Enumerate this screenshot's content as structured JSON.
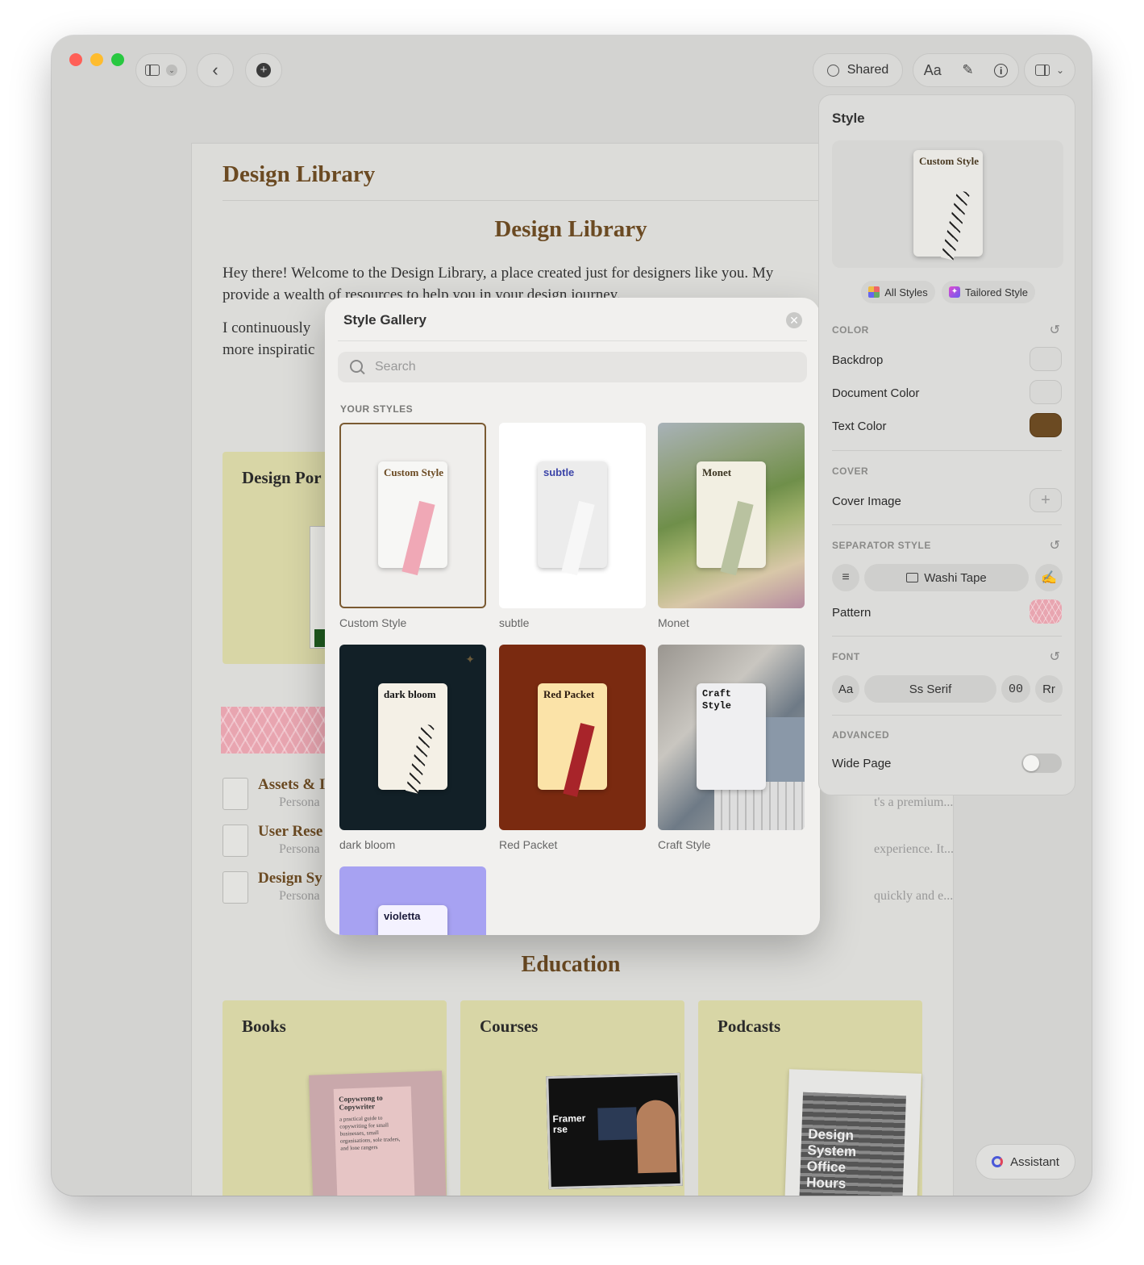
{
  "toolbar": {
    "shared_label": "Shared",
    "font_button_label": "Aa"
  },
  "document": {
    "header_title": "Design Library",
    "main_title": "Design Library",
    "intro_line1": "Hey there! Welcome to the Design Library, a place created just for designers like you. My",
    "intro_line2": "provide a wealth of resources to help you in your design journey.",
    "second_line1": "I continuously",
    "second_line2": "more inspiratic",
    "design_card_title": "Design Por",
    "list_items": [
      {
        "title": "Assets & I",
        "subtitle": "Persona"
      },
      {
        "title": "User Rese",
        "subtitle": "Persona"
      },
      {
        "title": "Design Sy",
        "subtitle": "Persona"
      }
    ],
    "right_snippets": [
      "t's a premium...",
      "experience. It...",
      "quickly and e..."
    ],
    "education_title": "Education",
    "edu_cards": [
      {
        "title": "Books"
      },
      {
        "title": "Courses"
      },
      {
        "title": "Podcasts"
      }
    ],
    "book_cover": {
      "title": "Copywrong to Copywriter",
      "text": "a practical guide to copywriting for small businesses, small organisations, sole traders, and lone rangers"
    },
    "course_cover": {
      "line1": "Framer",
      "line2": "rse"
    },
    "podcast_cover": {
      "text": "Design System Office Hours"
    }
  },
  "gallery": {
    "title": "Style Gallery",
    "search_placeholder": "Search",
    "section_label": "YOUR STYLES",
    "styles": [
      {
        "name": "Custom Style",
        "mini_title": "Custom Style"
      },
      {
        "name": "subtle",
        "mini_title": "subtle"
      },
      {
        "name": "Monet",
        "mini_title": "Monet"
      },
      {
        "name": "dark bloom",
        "mini_title": "dark bloom"
      },
      {
        "name": "Red Packet",
        "mini_title": "Red Packet"
      },
      {
        "name": "Craft Style",
        "mini_title": "Craft Style"
      },
      {
        "name": "violetta",
        "mini_title": "violetta"
      }
    ]
  },
  "style_panel": {
    "title": "Style",
    "preview_title": "Custom Style",
    "all_styles_label": "All Styles",
    "tailored_label": "Tailored Style",
    "color_section": "COLOR",
    "backdrop_label": "Backdrop",
    "document_color_label": "Document Color",
    "text_color_label": "Text Color",
    "text_color_value": "#6b4a22",
    "cover_section": "COVER",
    "cover_image_label": "Cover Image",
    "separator_section": "SEPARATOR STYLE",
    "separator_value": "Washi Tape",
    "pattern_label": "Pattern",
    "font_section": "FONT",
    "font_options": [
      "Aa",
      "Ss Serif",
      "00",
      "Rr"
    ],
    "advanced_section": "ADVANCED",
    "wide_page_label": "Wide Page"
  },
  "assistant": {
    "label": "Assistant"
  },
  "colors": {
    "accent_brown": "#6b4a22",
    "card_yellow": "#d8d6a6",
    "washi_pink": "#e8a5b0",
    "red_packet": "#7a2a10",
    "dark_bloom": "#122027",
    "violetta": "#a7a2f2"
  }
}
